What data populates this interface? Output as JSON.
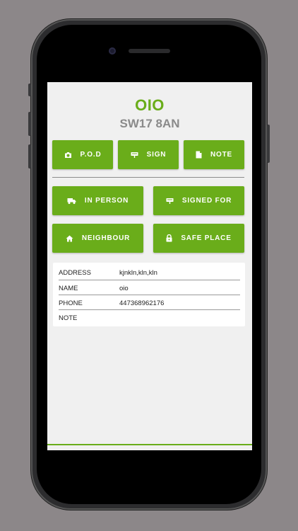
{
  "header": {
    "title": "OIO",
    "postcode": "SW17 8AN"
  },
  "actions": {
    "pod_label": "P.O.D",
    "sign_label": "SIGN",
    "note_label": "NOTE"
  },
  "delivery_options": {
    "in_person_label": "IN PERSON",
    "signed_for_label": "SIGNED FOR",
    "neighbour_label": "NEIGHBOUR",
    "safe_place_label": "SAFE PLACE"
  },
  "details": [
    {
      "label": "ADDRESS",
      "value": "kjnkln,kln,kln"
    },
    {
      "label": "NAME",
      "value": "oio"
    },
    {
      "label": "PHONE",
      "value": "447368962176"
    },
    {
      "label": "NOTE",
      "value": ""
    }
  ],
  "colors": {
    "accent": "#6aad1a",
    "subtitle": "#8a8a8a",
    "screen_bg": "#f0f0f0",
    "device_bg": "#8c8789"
  },
  "icons": {
    "pod": "camera-icon",
    "sign": "signature-icon",
    "note": "note-icon",
    "in_person": "truck-icon",
    "signed_for": "signature-icon",
    "neighbour": "home-icon",
    "safe_place": "lock-icon"
  }
}
